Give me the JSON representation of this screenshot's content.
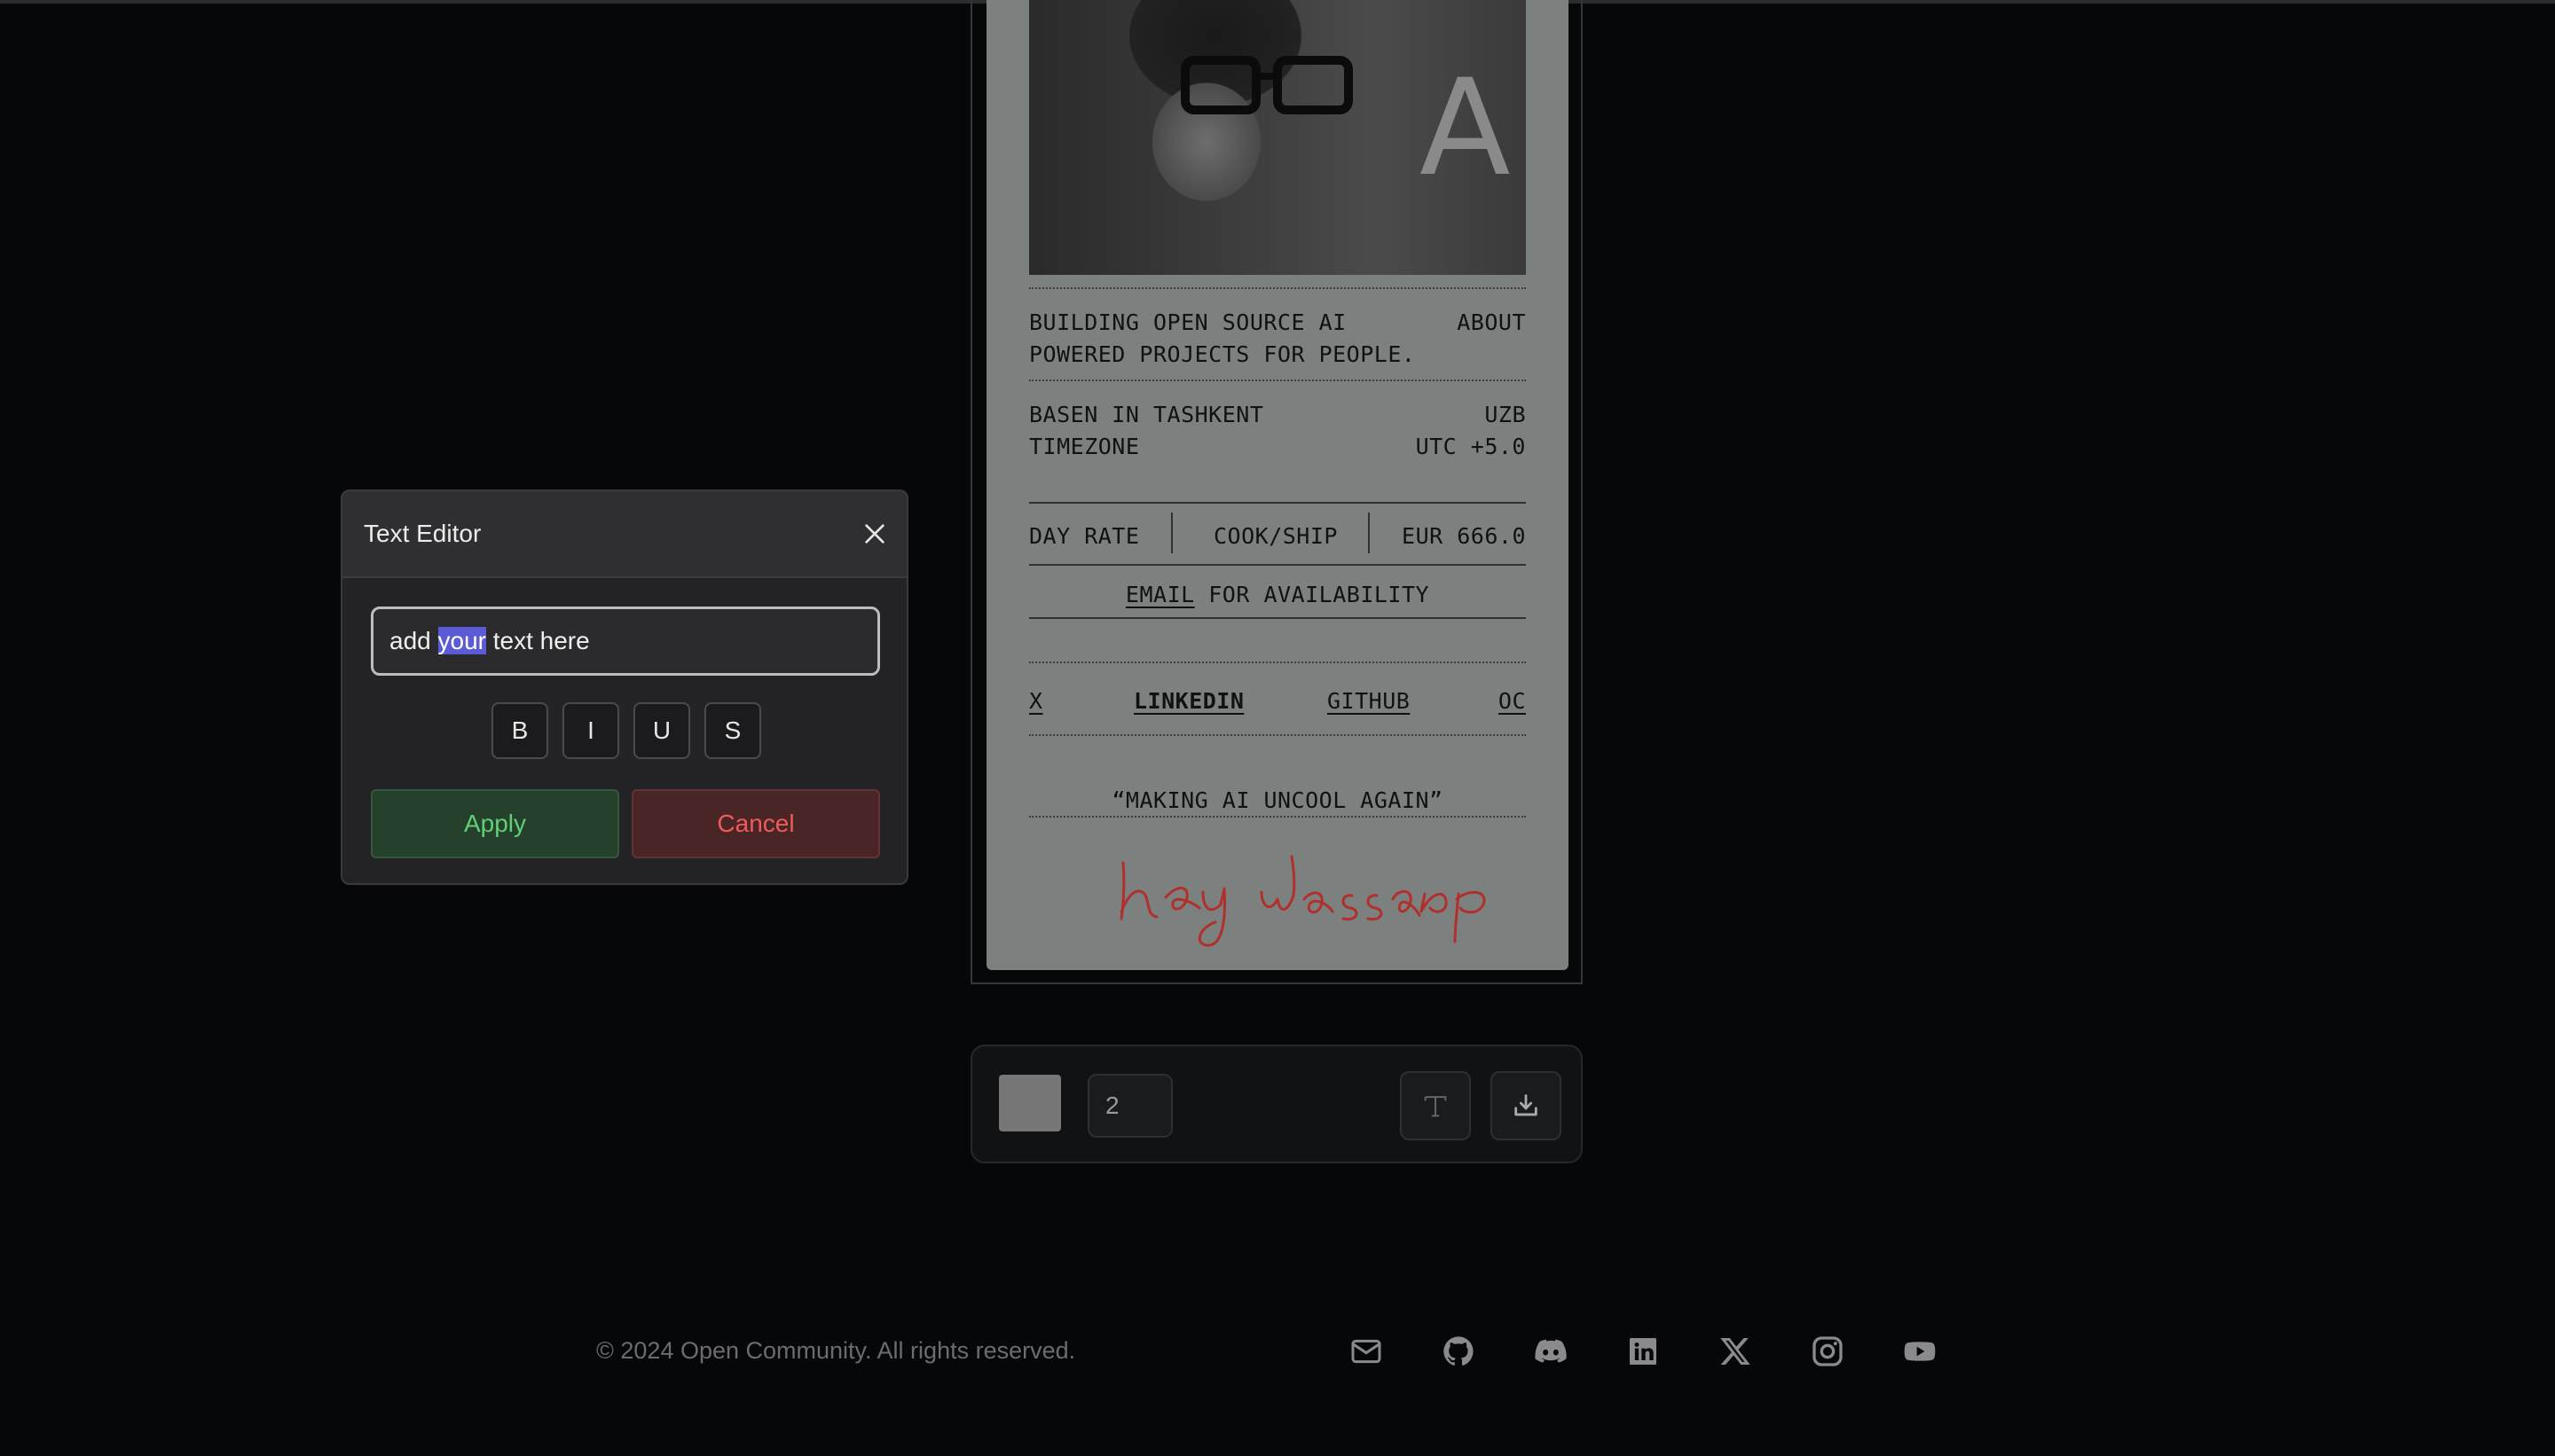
{
  "card": {
    "tagline_line1": "BUILDING OPEN SOURCE AI",
    "tagline_line2": "POWERED PROJECTS FOR PEOPLE.",
    "about": "ABOUT",
    "location_line": "BASEN IN TASHKENT",
    "country": "UZB",
    "timezone_label": "TIMEZONE",
    "timezone_value": "UTC +5.0",
    "rate_label": "DAY RATE",
    "rate_role": "COOK/SHIP",
    "rate_value": "EUR 666.0",
    "email_link": "EMAIL",
    "availability_text": "FOR AVAILABILITY",
    "links": [
      "X",
      "LINKEDIN",
      "GITHUB",
      "OC"
    ],
    "quote": "“MAKING AI UNCOOL AGAIN”",
    "signature_text": "hey wassup",
    "signature_color": "#b0302c"
  },
  "toolbar": {
    "swatch_color": "#777777",
    "brush_size": "2",
    "text_tool_icon": "text-icon",
    "download_icon": "download-icon"
  },
  "dialog": {
    "title": "Text Editor",
    "input_before": "add ",
    "input_selected": "your",
    "input_after": " text here",
    "format_buttons": [
      "B",
      "I",
      "U",
      "S"
    ],
    "apply_label": "Apply",
    "cancel_label": "Cancel"
  },
  "footer": {
    "copyright": "© 2024 Open Community. All rights reserved.",
    "social_icons": [
      "mail-icon",
      "github-icon",
      "discord-icon",
      "linkedin-icon",
      "x-icon",
      "instagram-icon",
      "youtube-icon"
    ]
  }
}
